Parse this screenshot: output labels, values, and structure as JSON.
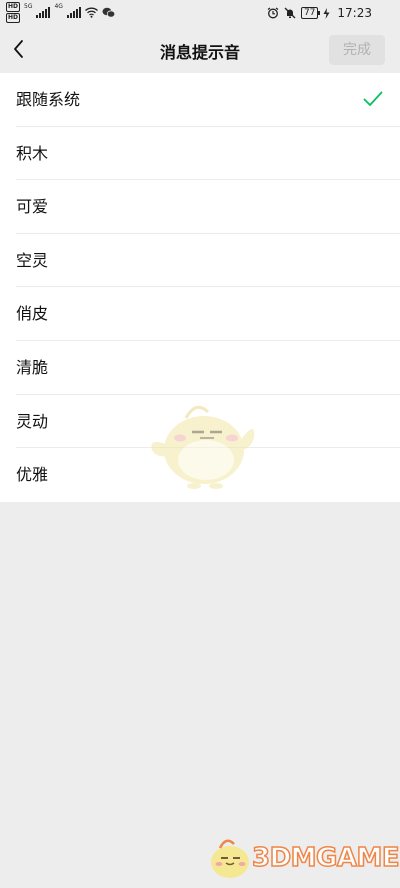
{
  "status_bar": {
    "hd_badges": [
      "HD",
      "HD"
    ],
    "network_labels": [
      "5G",
      "4G"
    ],
    "battery": "77",
    "time": "17:23"
  },
  "header": {
    "title": "消息提示音",
    "done_label": "完成"
  },
  "sounds": [
    {
      "label": "跟随系统",
      "selected": true
    },
    {
      "label": "积木",
      "selected": false
    },
    {
      "label": "可爱",
      "selected": false
    },
    {
      "label": "空灵",
      "selected": false
    },
    {
      "label": "俏皮",
      "selected": false
    },
    {
      "label": "清脆",
      "selected": false
    },
    {
      "label": "灵动",
      "selected": false
    },
    {
      "label": "优雅",
      "selected": false
    }
  ],
  "watermark": {
    "logo_text": "3DMGAME"
  },
  "colors": {
    "accent": "#07c160",
    "background": "#ededed",
    "done_disabled_bg": "#e1e1e1",
    "done_disabled_text": "#b2b2b2",
    "watermark": "#f07a35"
  }
}
